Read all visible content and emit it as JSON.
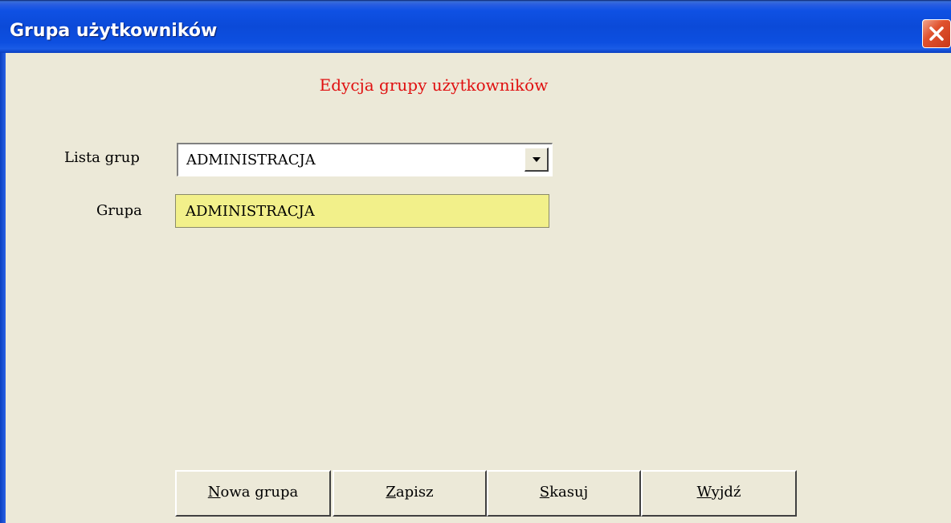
{
  "window": {
    "title": "Grupa użytkowników"
  },
  "form": {
    "heading": "Edycja grupy użytkowników",
    "group_list": {
      "label": "Lista grup",
      "selected": "ADMINISTRACJA"
    },
    "group": {
      "label": "Grupa",
      "value": "ADMINISTRACJA"
    }
  },
  "buttons": [
    {
      "mnemonic": "N",
      "rest": "owa grupa"
    },
    {
      "mnemonic": "Z",
      "rest": "apisz"
    },
    {
      "mnemonic": "S",
      "rest": "kasuj"
    },
    {
      "mnemonic": "W",
      "rest": "yjdź"
    }
  ],
  "colors": {
    "heading": "#e01010",
    "group_field_bg": "#f2f08a",
    "window_bg": "#ece9d8",
    "titlebar": "#0b4ad8"
  },
  "icons": {
    "close": "close-icon",
    "dropdown": "chevron-down-icon"
  }
}
